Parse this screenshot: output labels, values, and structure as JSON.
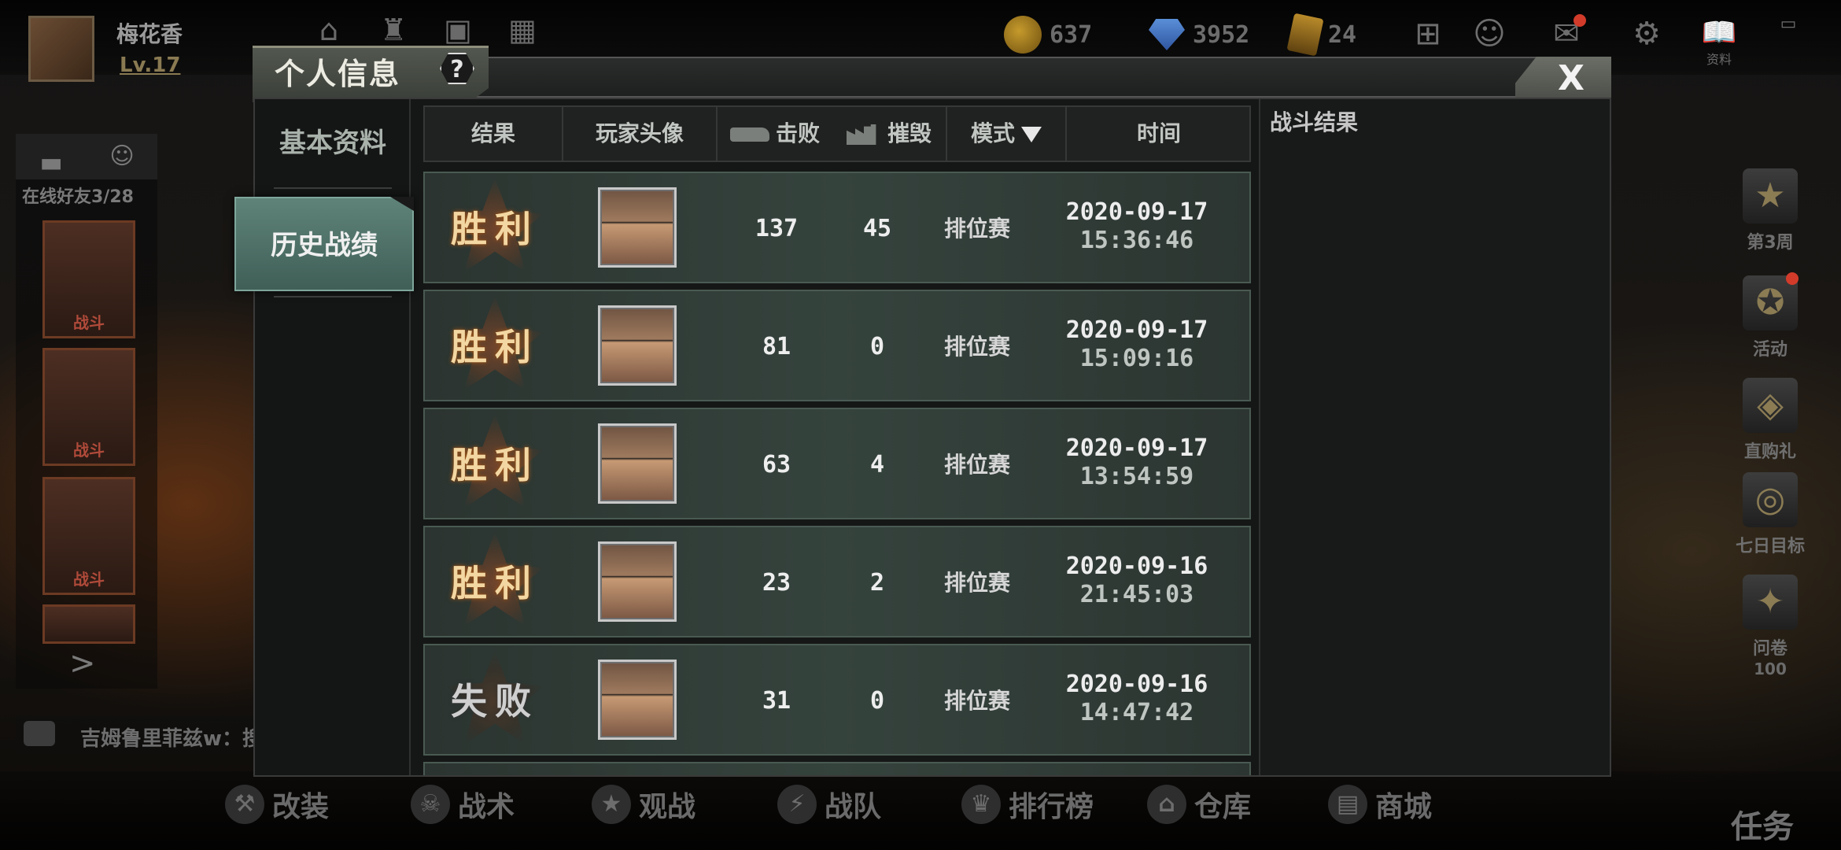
{
  "player": {
    "name": "梅花香",
    "level": "Lv.17"
  },
  "top_icons": {
    "home_label": "",
    "shop_badge": "",
    "menu_label": ""
  },
  "currencies": [
    {
      "icon": "gold-coin-icon",
      "value": "637"
    },
    {
      "icon": "diamond-icon",
      "value": "3952"
    },
    {
      "icon": "ticket-icon",
      "value": "24"
    }
  ],
  "top_right": {
    "profile_label": "资料"
  },
  "social": {
    "online_friends": "在线好友3/28",
    "friend_status": "战斗"
  },
  "chat": {
    "text": "吉姆鲁里菲兹w：搜"
  },
  "side_events": [
    {
      "label": "第3周",
      "icon": "star-medal-icon"
    },
    {
      "label": "活动",
      "icon": "event-star-icon"
    },
    {
      "label": "直购礼",
      "icon": "gift-badge-icon"
    },
    {
      "label": "七日目标",
      "icon": "coins-stack-icon"
    },
    {
      "label": "问卷",
      "icon": "survey-icon"
    }
  ],
  "survey_reward": "100",
  "bottom_nav": [
    {
      "label": "改装",
      "icon": "wrench-icon"
    },
    {
      "label": "战术",
      "icon": "gasmask-icon"
    },
    {
      "label": "观战",
      "icon": "star-badge-icon"
    },
    {
      "label": "战队",
      "icon": "shield-bolt-icon"
    },
    {
      "label": "排行榜",
      "icon": "trophy-icon"
    },
    {
      "label": "仓库",
      "icon": "warehouse-icon"
    },
    {
      "label": "商城",
      "icon": "store-icon"
    }
  ],
  "task_label": "任务",
  "modal": {
    "title": "个人信息",
    "help": "?",
    "close": "X",
    "menu": [
      {
        "label": "基本资料",
        "active": false
      },
      {
        "label": "历史战绩",
        "active": true
      }
    ],
    "columns": {
      "result": "结果",
      "avatar": "玩家头像",
      "kills": "击败",
      "destroy": "摧毁",
      "mode": "模式",
      "time": "时间"
    },
    "matches": [
      {
        "result": "胜利",
        "won": true,
        "kills": "137",
        "destroy": "45",
        "mode": "排位赛",
        "date": "2020-09-17",
        "time": "15:36:46"
      },
      {
        "result": "胜利",
        "won": true,
        "kills": "81",
        "destroy": "0",
        "mode": "排位赛",
        "date": "2020-09-17",
        "time": "15:09:16"
      },
      {
        "result": "胜利",
        "won": true,
        "kills": "63",
        "destroy": "4",
        "mode": "排位赛",
        "date": "2020-09-17",
        "time": "13:54:59"
      },
      {
        "result": "胜利",
        "won": true,
        "kills": "23",
        "destroy": "2",
        "mode": "排位赛",
        "date": "2020-09-16",
        "time": "21:45:03"
      },
      {
        "result": "失败",
        "won": false,
        "kills": "31",
        "destroy": "0",
        "mode": "排位赛",
        "date": "2020-09-16",
        "time": "14:47:42"
      }
    ],
    "battle_result_title": "战斗结果"
  }
}
